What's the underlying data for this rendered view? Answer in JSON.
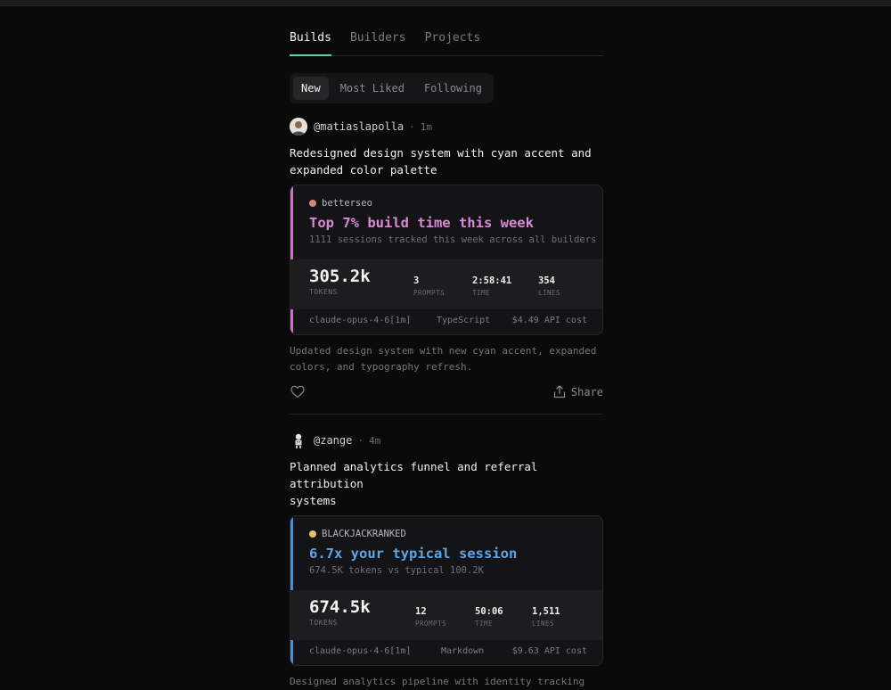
{
  "tabs": [
    {
      "label": "Builds"
    },
    {
      "label": "Builders"
    },
    {
      "label": "Projects"
    }
  ],
  "filters": [
    {
      "label": "New"
    },
    {
      "label": "Most Liked"
    },
    {
      "label": "Following"
    }
  ],
  "accent_color": "#5fd0b4",
  "posts": [
    {
      "handle": "@matiaslapolla",
      "separator": "·",
      "age": "1m",
      "title_line1": "Redesigned design system with cyan accent and",
      "title_line2": "expanded color palette",
      "card": {
        "accent": "#c774c3",
        "project_dot": "#d08a7e",
        "project": "betterseo",
        "headline": "Top 7% build time this week",
        "headline_color": "#d98ad6",
        "subline": "1111 sessions tracked this week across all builders",
        "tokens_value": "305.2k",
        "tokens_label": "TOKENS",
        "prompts_value": "3",
        "prompts_label": "PROMPTS",
        "time_value": "2:58:41",
        "time_label": "TIME",
        "lines_value": "354",
        "lines_label": "LINES",
        "model": "claude-opus-4-6[1m]",
        "language": "TypeScript",
        "cost": "$4.49 API cost"
      },
      "desc_line1": "Updated design system with new cyan accent, expanded",
      "desc_line2": "colors, and typography refresh.",
      "share_label": "Share"
    },
    {
      "handle": "@zange",
      "separator": "·",
      "age": "4m",
      "title_line1": "Planned analytics funnel and referral attribution",
      "title_line2": "systems",
      "card": {
        "accent": "#4a8fd6",
        "project_dot": "#e2c16e",
        "project": "BLACKJACKRANKED",
        "headline": "6.7x your typical session",
        "headline_color": "#5aa6e8",
        "subline": "674.5K tokens vs typical 100.2K",
        "tokens_value": "674.5k",
        "tokens_label": "TOKENS",
        "prompts_value": "12",
        "prompts_label": "PROMPTS",
        "time_value": "50:06",
        "time_label": "TIME",
        "lines_value": "1,511",
        "lines_label": "LINES",
        "model": "claude-opus-4-6[1m]",
        "language": "Markdown",
        "cost": "$9.63 API cost"
      },
      "desc_line1": "Designed analytics pipeline with identity tracking"
    }
  ]
}
